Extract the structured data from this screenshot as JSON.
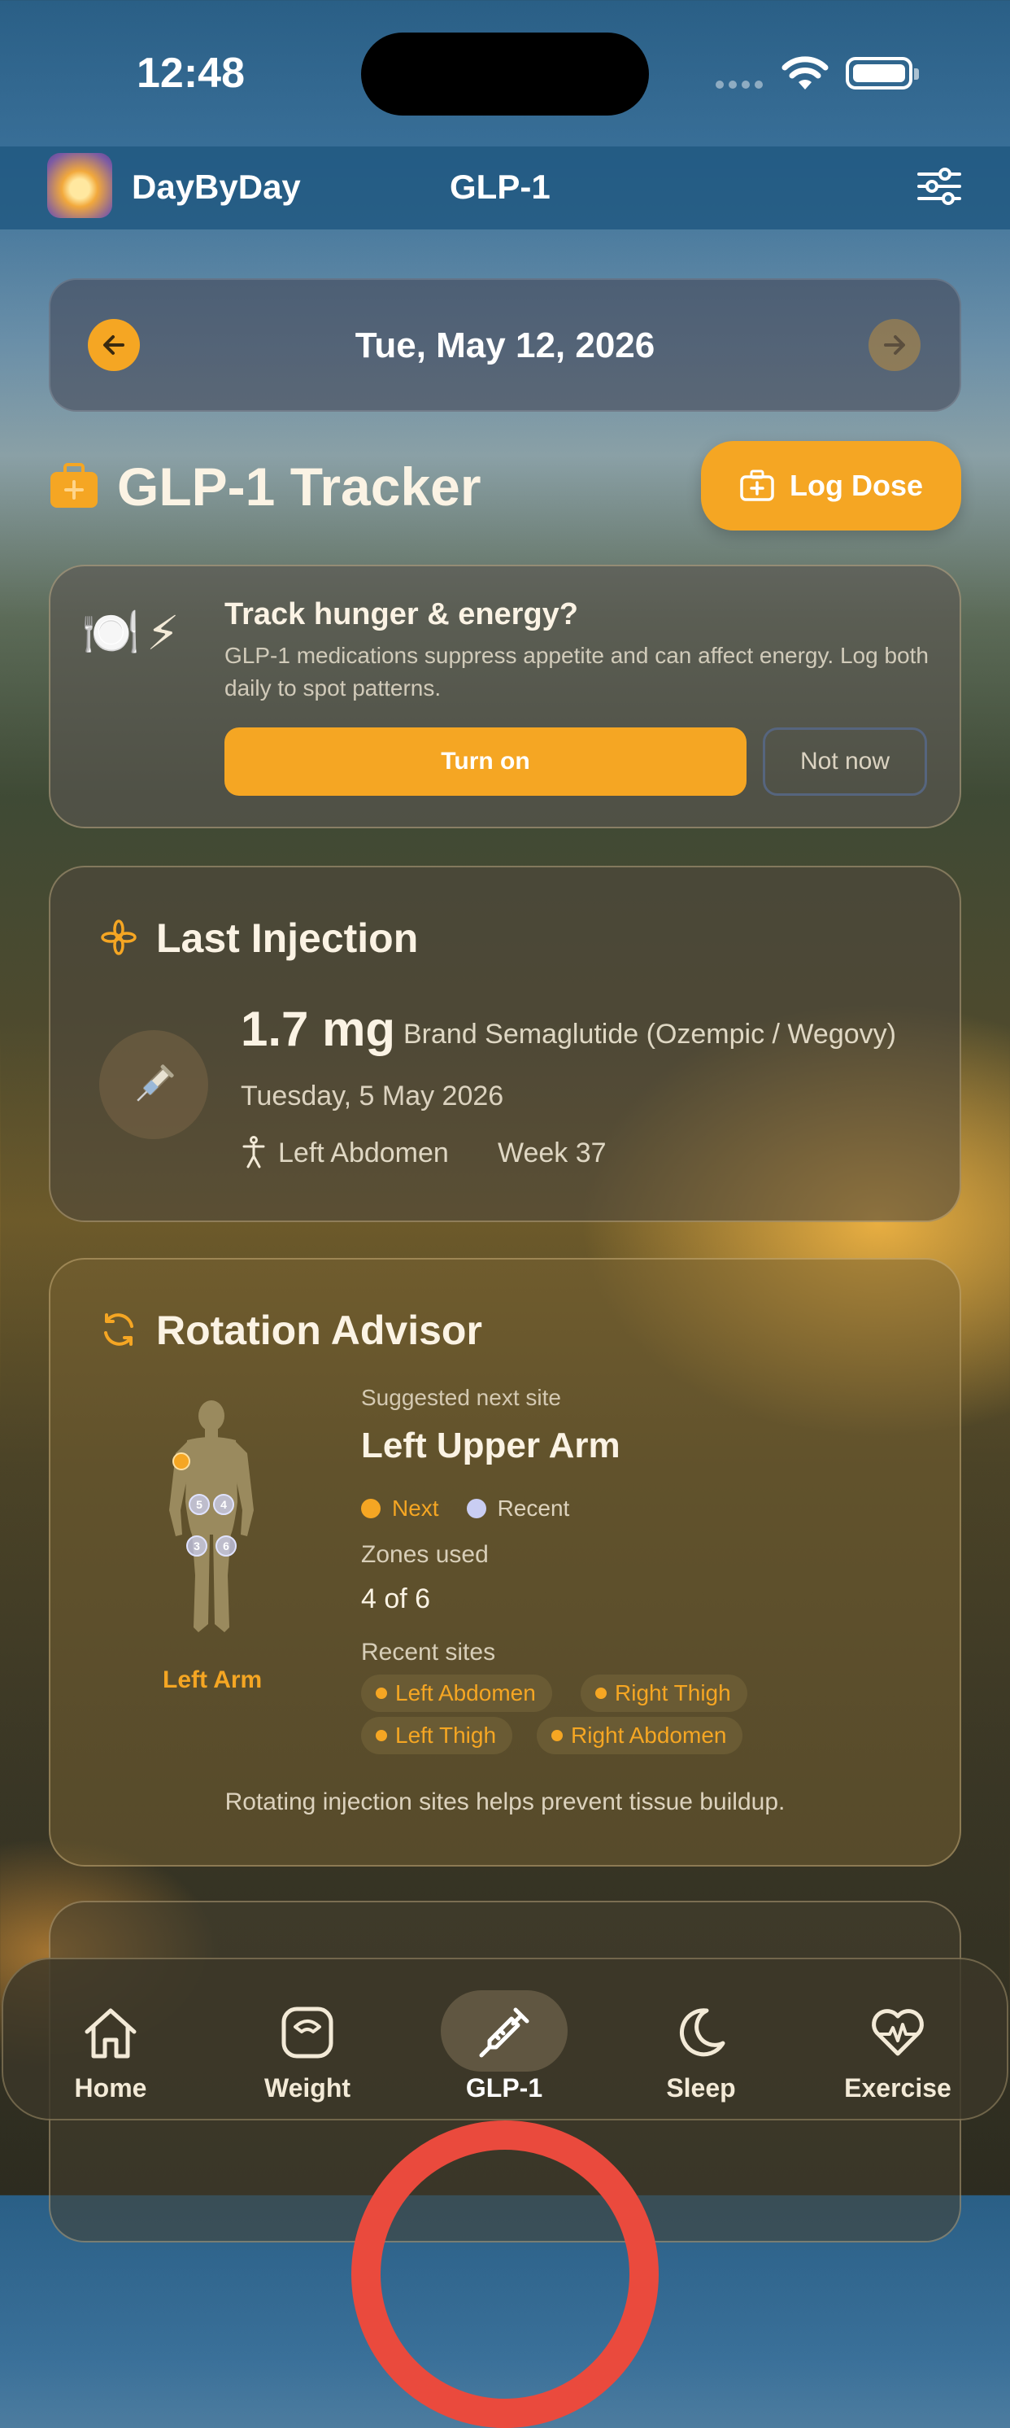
{
  "status": {
    "time": "12:48"
  },
  "header": {
    "app_name": "DayByDay",
    "page_title": "GLP-1"
  },
  "date_nav": {
    "date": "Tue, May 12, 2026"
  },
  "tracker": {
    "title": "GLP-1 Tracker",
    "log_button": "Log Dose"
  },
  "prompt_card": {
    "icons": [
      "plate-icon",
      "lightning-icon"
    ],
    "title": "Track hunger & energy?",
    "description": "GLP-1 medications suppress appetite and can affect energy. Log both daily to spot patterns.",
    "primary_button": "Turn on",
    "secondary_button": "Not now"
  },
  "last_injection": {
    "title": "Last Injection",
    "dose": "1.7 mg",
    "brand": "Brand Semaglutide (Ozempic / Wegovy)",
    "date": "Tuesday, 5 May 2026",
    "site": "Left Abdomen",
    "week": "Week 37"
  },
  "rotation": {
    "title": "Rotation Advisor",
    "body_label": "Left Arm",
    "zone_numbers": [
      "5",
      "4",
      "3",
      "6"
    ],
    "suggested_label": "Suggested next site",
    "suggested_site": "Left Upper Arm",
    "legend_next": "Next",
    "legend_recent": "Recent",
    "zones_label": "Zones used",
    "zones_value": "4 of 6",
    "recent_label": "Recent sites",
    "recent_sites": [
      "Left Abdomen",
      "Right Thigh",
      "Left Thigh",
      "Right Abdomen"
    ],
    "note": "Rotating injection sites helps prevent tissue buildup."
  },
  "colors": {
    "accent": "#f5a623",
    "recent": "#c9cdf2",
    "ring": "#ea4a3d"
  },
  "tabbar": {
    "items": [
      {
        "label": "Home",
        "icon": "home-icon"
      },
      {
        "label": "Weight",
        "icon": "scale-icon"
      },
      {
        "label": "GLP-1",
        "icon": "syringe-icon",
        "selected": true
      },
      {
        "label": "Sleep",
        "icon": "moon-icon"
      },
      {
        "label": "Exercise",
        "icon": "heart-pulse-icon"
      }
    ]
  }
}
